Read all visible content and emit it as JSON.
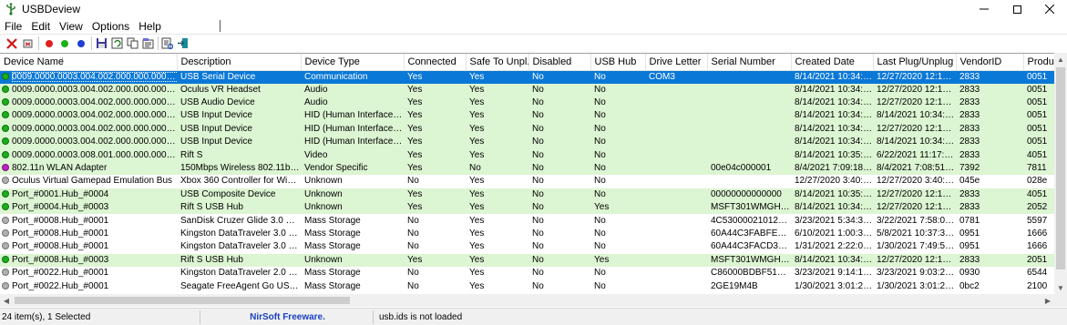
{
  "window": {
    "title": "USBDeview"
  },
  "menu": [
    "File",
    "Edit",
    "View",
    "Options",
    "Help"
  ],
  "toolbar": {
    "icons": [
      "delete-icon",
      "disconnect-icon",
      "red-dot-icon",
      "green-dot-icon",
      "blue-dot-icon",
      "save-icon",
      "refresh-icon",
      "copy-icon",
      "properties-icon",
      "html-report-icon",
      "exit-icon"
    ],
    "colors": {
      "red": "#e02020",
      "green": "#19b019",
      "blue": "#1f3fd0"
    }
  },
  "list": {
    "columns": [
      "Device Name",
      "Description",
      "Device Type",
      "Connected",
      "Safe To Unpl...",
      "Disabled",
      "USB Hub",
      "Drive Letter",
      "Serial Number",
      "Created Date",
      "Last Plug/Unplug ...",
      "VendorID",
      "Produ"
    ],
    "rows": [
      {
        "state": "selected",
        "dot": "#19b019",
        "cells": [
          "0009.0000.0003.004.002.000.000.000.000",
          "USB Serial Device",
          "Communication",
          "Yes",
          "Yes",
          "No",
          "No",
          "COM3",
          "",
          "8/14/2021 10:34:53...",
          "12/27/2020 12:13:5...",
          "2833",
          "0051"
        ]
      },
      {
        "state": "connected",
        "dot": "#19b019",
        "cells": [
          "0009.0000.0003.004.002.000.000.000.000",
          "Oculus VR Headset",
          "Audio",
          "Yes",
          "Yes",
          "No",
          "No",
          "",
          "",
          "8/14/2021 10:34:53...",
          "12/27/2020 12:13:5...",
          "2833",
          "0051"
        ]
      },
      {
        "state": "connected",
        "dot": "#19b019",
        "cells": [
          "0009.0000.0003.004.002.000.000.000.000",
          "USB Audio Device",
          "Audio",
          "Yes",
          "Yes",
          "No",
          "No",
          "",
          "",
          "8/14/2021 10:34:53...",
          "12/27/2020 12:13:5...",
          "2833",
          "0051"
        ]
      },
      {
        "state": "connected",
        "dot": "#19b019",
        "cells": [
          "0009.0000.0003.004.002.000.000.000.000",
          "USB Input Device",
          "HID (Human Interface D...",
          "Yes",
          "Yes",
          "No",
          "No",
          "",
          "",
          "8/14/2021 10:34:53...",
          "8/14/2021 10:34:53...",
          "2833",
          "0051"
        ]
      },
      {
        "state": "connected",
        "dot": "#19b019",
        "cells": [
          "0009.0000.0003.004.002.000.000.000.000",
          "USB Input Device",
          "HID (Human Interface D...",
          "Yes",
          "Yes",
          "No",
          "No",
          "",
          "",
          "8/14/2021 10:34:53...",
          "12/27/2020 12:13:5...",
          "2833",
          "0051"
        ]
      },
      {
        "state": "connected",
        "dot": "#19b019",
        "cells": [
          "0009.0000.0003.004.002.000.000.000.000",
          "USB Input Device",
          "HID (Human Interface D...",
          "Yes",
          "Yes",
          "No",
          "No",
          "",
          "",
          "8/14/2021 10:34:53...",
          "8/14/2021 10:34:53...",
          "2833",
          "0051"
        ]
      },
      {
        "state": "connected",
        "dot": "#19b019",
        "cells": [
          "0009.0000.0003.008.001.000.000.000.000",
          "Rift S",
          "Video",
          "Yes",
          "Yes",
          "No",
          "No",
          "",
          "",
          "8/14/2021 10:35:16...",
          "6/22/2021 11:17:12...",
          "2833",
          "4051"
        ]
      },
      {
        "state": "connected",
        "dot": "#c020c0",
        "cells": [
          "802.11n WLAN Adapter",
          "150Mbps Wireless 802.11bgn ...",
          "Vendor Specific",
          "Yes",
          "No",
          "No",
          "No",
          "",
          "00e04c000001",
          "8/4/2021 7:09:18 PM",
          "8/4/2021 7:08:51 PM",
          "7392",
          "7811"
        ]
      },
      {
        "state": "disconnected",
        "dot": "#b0b0b0",
        "cells": [
          "Oculus Virtual Gamepad Emulation Bus",
          "Xbox 360 Controller for Wind...",
          "Unknown",
          "No",
          "Yes",
          "No",
          "No",
          "",
          "",
          "12/27/2020 3:40:53...",
          "12/27/2020 3:40:53...",
          "045e",
          "028e"
        ]
      },
      {
        "state": "connected",
        "dot": "#19b019",
        "cells": [
          "Port_#0001.Hub_#0004",
          "USB Composite Device",
          "Unknown",
          "Yes",
          "Yes",
          "No",
          "No",
          "",
          "00000000000000",
          "8/14/2021 10:35:16...",
          "12/27/2020 12:13:5...",
          "2833",
          "4051"
        ]
      },
      {
        "state": "connected",
        "dot": "#19b019",
        "cells": [
          "Port_#0004.Hub_#0003",
          "Rift S USB Hub",
          "Unknown",
          "Yes",
          "Yes",
          "No",
          "Yes",
          "",
          "MSFT301WMGH52...",
          "8/14/2021 10:34:44...",
          "12/27/2020 12:13:4...",
          "2833",
          "2052"
        ]
      },
      {
        "state": "disconnected",
        "dot": "#b0b0b0",
        "cells": [
          "Port_#0008.Hub_#0001",
          "SanDisk Cruzer Glide 3.0 USB ...",
          "Mass Storage",
          "No",
          "Yes",
          "No",
          "No",
          "",
          "4C530000210121O...",
          "3/23/2021 5:34:35 ...",
          "3/22/2021 7:58:05 ...",
          "0781",
          "5597"
        ]
      },
      {
        "state": "disconnected",
        "dot": "#b0b0b0",
        "cells": [
          "Port_#0008.Hub_#0001",
          "Kingston DataTraveler 3.0 USB ...",
          "Mass Storage",
          "No",
          "Yes",
          "No",
          "No",
          "",
          "60A44C3FABFEB36...",
          "6/10/2021 1:00:33 ...",
          "5/8/2021 10:37:36 ...",
          "0951",
          "1666"
        ]
      },
      {
        "state": "disconnected",
        "dot": "#b0b0b0",
        "cells": [
          "Port_#0008.Hub_#0001",
          "Kingston DataTraveler 3.0 USB ...",
          "Mass Storage",
          "No",
          "Yes",
          "No",
          "No",
          "",
          "60A44C3FACD3B3...",
          "1/31/2021 2:22:08 ...",
          "1/30/2021 7:49:59 ...",
          "0951",
          "1666"
        ]
      },
      {
        "state": "connected",
        "dot": "#19b019",
        "cells": [
          "Port_#0008.Hub_#0003",
          "Rift S USB Hub",
          "Unknown",
          "Yes",
          "Yes",
          "No",
          "Yes",
          "",
          "MSFT301WMGH52...",
          "8/14/2021 10:34:44...",
          "12/27/2020 12:13:4...",
          "2833",
          "2051"
        ]
      },
      {
        "state": "disconnected",
        "dot": "#b0b0b0",
        "cells": [
          "Port_#0022.Hub_#0001",
          "Kingston DataTraveler 2.0 USB ...",
          "Mass Storage",
          "No",
          "Yes",
          "No",
          "No",
          "",
          "C86000BDBF51C0...",
          "3/23/2021 9:14:12 ...",
          "3/23/2021 9:03:28 ...",
          "0930",
          "6544"
        ]
      },
      {
        "state": "disconnected",
        "dot": "#b0b0b0",
        "cells": [
          "Port_#0022.Hub_#0001",
          "Seagate FreeAgent Go USB De...",
          "Mass Storage",
          "No",
          "Yes",
          "No",
          "No",
          "",
          "2GE19M4B",
          "1/30/2021 3:01:28 ...",
          "1/30/2021 3:01:28 ...",
          "0bc2",
          "2100"
        ]
      }
    ]
  },
  "statusbar": {
    "count": "24 item(s), 1 Selected",
    "nirsoft": "NirSoft Freeware.  http://www.nirsoft.net",
    "message": "usb.ids is not loaded"
  }
}
